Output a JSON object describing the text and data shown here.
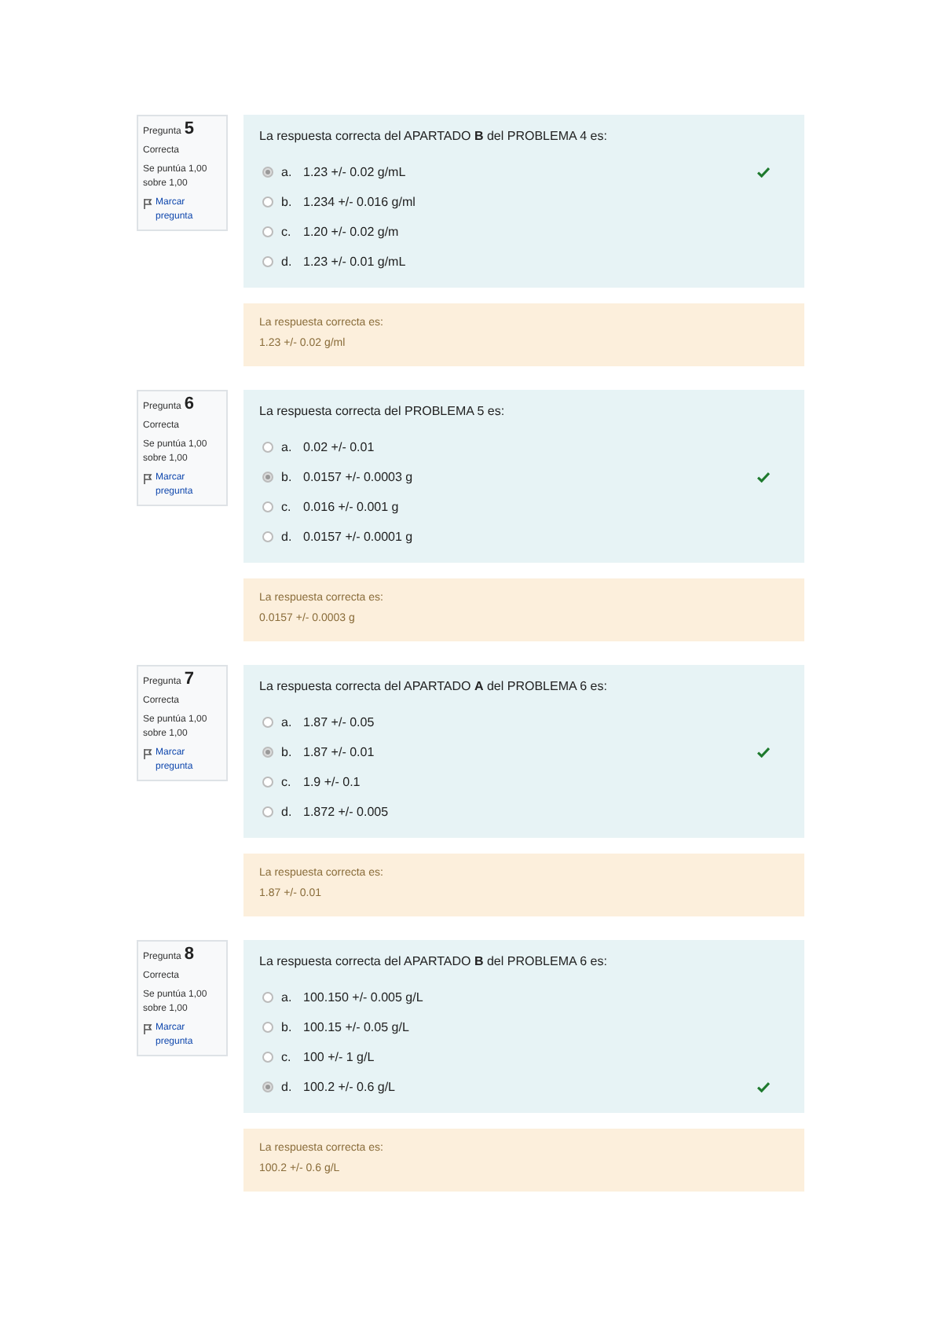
{
  "questions": [
    {
      "label": "Pregunta",
      "number": "5",
      "status": "Correcta",
      "score": "Se puntúa 1,00 sobre 1,00",
      "flag": "Marcar pregunta",
      "prompt": "La respuesta correcta del APARTADO **B** del PROBLEMA 4 es:",
      "options": [
        {
          "letter": "a.",
          "text": "1.23 +/- 0.02 g/mL",
          "selected": true,
          "correct": true
        },
        {
          "letter": "b.",
          "text": "1.234 +/- 0.016 g/ml",
          "selected": false,
          "correct": false
        },
        {
          "letter": "c.",
          "text": "1.20 +/- 0.02 g/m",
          "selected": false,
          "correct": false
        },
        {
          "letter": "d.",
          "text": "1.23 +/- 0.01 g/mL",
          "selected": false,
          "correct": false
        }
      ],
      "feedback_label": "La respuesta correcta es:",
      "feedback_answer": "1.23 +/- 0.02 g/ml"
    },
    {
      "label": "Pregunta",
      "number": "6",
      "status": "Correcta",
      "score": "Se puntúa 1,00 sobre 1,00",
      "flag": "Marcar pregunta",
      "prompt": "La respuesta correcta del PROBLEMA 5 es:",
      "options": [
        {
          "letter": "a.",
          "text": "0.02 +/- 0.01",
          "selected": false,
          "correct": false
        },
        {
          "letter": "b.",
          "text": "0.0157 +/- 0.0003 g",
          "selected": true,
          "correct": true
        },
        {
          "letter": "c.",
          "text": "0.016 +/- 0.001 g",
          "selected": false,
          "correct": false
        },
        {
          "letter": "d.",
          "text": "0.0157 +/- 0.0001 g",
          "selected": false,
          "correct": false
        }
      ],
      "feedback_label": "La respuesta correcta es:",
      "feedback_answer": "0.0157 +/- 0.0003 g"
    },
    {
      "label": "Pregunta",
      "number": "7",
      "status": "Correcta",
      "score": "Se puntúa 1,00 sobre 1,00",
      "flag": "Marcar pregunta",
      "prompt": "La respuesta correcta del APARTADO **A** del PROBLEMA 6 es:",
      "options": [
        {
          "letter": "a.",
          "text": "1.87 +/- 0.05",
          "selected": false,
          "correct": false
        },
        {
          "letter": "b.",
          "text": "1.87 +/- 0.01",
          "selected": true,
          "correct": true
        },
        {
          "letter": "c.",
          "text": "1.9 +/- 0.1",
          "selected": false,
          "correct": false
        },
        {
          "letter": "d.",
          "text": "1.872 +/- 0.005",
          "selected": false,
          "correct": false
        }
      ],
      "feedback_label": "La respuesta correcta es:",
      "feedback_answer": "1.87 +/- 0.01"
    },
    {
      "label": "Pregunta",
      "number": "8",
      "status": "Correcta",
      "score": "Se puntúa 1,00 sobre 1,00",
      "flag": "Marcar pregunta",
      "prompt": "La respuesta correcta del APARTADO **B** del PROBLEMA 6 es:",
      "options": [
        {
          "letter": "a.",
          "text": "100.150 +/- 0.005 g/L",
          "selected": false,
          "correct": false
        },
        {
          "letter": "b.",
          "text": "100.15 +/- 0.05 g/L",
          "selected": false,
          "correct": false
        },
        {
          "letter": "c.",
          "text": "100 +/- 1 g/L",
          "selected": false,
          "correct": false
        },
        {
          "letter": "d.",
          "text": "100.2 +/- 0.6 g/L",
          "selected": true,
          "correct": true
        }
      ],
      "feedback_label": "La respuesta correcta es:",
      "feedback_answer": "100.2 +/- 0.6 g/L"
    }
  ]
}
